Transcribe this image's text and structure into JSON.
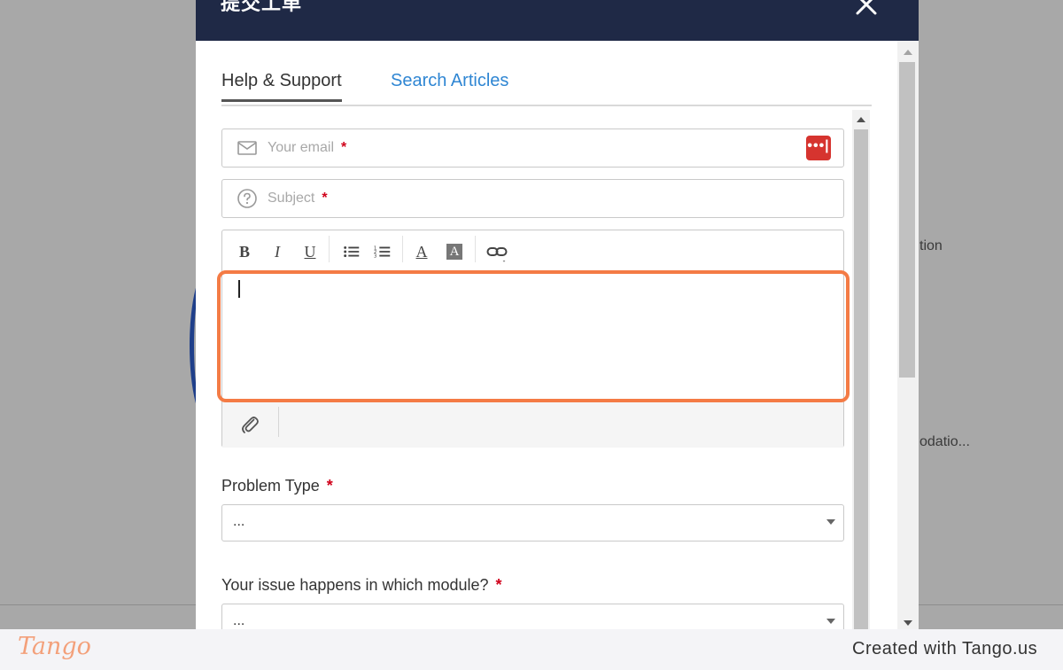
{
  "background": {
    "text_1": "tion",
    "text_2": "odatio..."
  },
  "modal": {
    "title": "提交工单",
    "tabs": [
      {
        "label": "Help & Support",
        "active": true
      },
      {
        "label": "Search Articles",
        "active": false
      }
    ],
    "email_field": {
      "placeholder": "Your email",
      "required_mark": "*",
      "icon": "envelope-icon",
      "autofill_icon": "password-manager-icon"
    },
    "subject_field": {
      "placeholder": "Subject",
      "required_mark": "*",
      "icon": "question-circle-icon"
    },
    "editor": {
      "toolbar": [
        {
          "name": "bold",
          "label": "B"
        },
        {
          "name": "italic",
          "label": "I"
        },
        {
          "name": "underline",
          "label": "U"
        },
        {
          "name": "bullet-list",
          "icon": "bullet-list-icon"
        },
        {
          "name": "numbered-list",
          "icon": "numbered-list-icon"
        },
        {
          "name": "text-color",
          "label": "A"
        },
        {
          "name": "background-color",
          "label": "A"
        },
        {
          "name": "link",
          "icon": "link-icon"
        }
      ],
      "attach_icon": "paperclip-icon"
    },
    "problem_type": {
      "label": "Problem Type",
      "required_mark": "*",
      "value": "..."
    },
    "module": {
      "label": "Your issue happens in which module?",
      "required_mark": "*",
      "value": "..."
    }
  },
  "footer": {
    "logo": "Tango",
    "created_with": "Created with Tango.us"
  },
  "colors": {
    "header_bg": "#1f2946",
    "tab_link": "#2f86d3",
    "required": "#d0021b",
    "highlight": "#f47b45",
    "backdrop": "#a8a8a8"
  }
}
